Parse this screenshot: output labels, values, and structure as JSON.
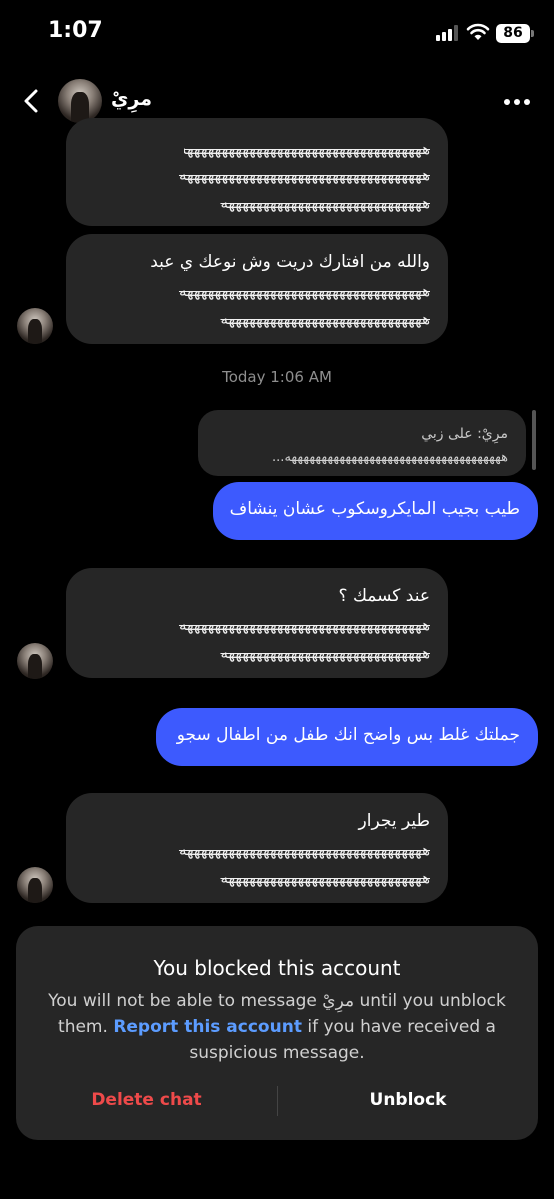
{
  "status_bar": {
    "time": "1:07",
    "battery": "86"
  },
  "header": {
    "contact_name": "مرِيْ"
  },
  "messages": {
    "m1": {
      "laugh_1": "هههههههههههههههههههههههههههههههههههه",
      "laugh_2": "هههههههههههههههههههههههههههههههههههه",
      "laugh_3": "هههههههههههههههههههههههههههههه"
    },
    "m2": {
      "text": "والله من افتارك دريت وش نوعك ي عبد",
      "laugh_1": "هههههههههههههههههههههههههههههههههههه",
      "laugh_2": "هههههههههههههههههههههههههههههه"
    },
    "timestamp": "Today 1:06 AM",
    "reply": {
      "name": "مرِيْ: على زبي",
      "text": "ههههههههههههههههههههههههههههههههههههه..."
    },
    "m3": {
      "text": "طيب بجيب المايكروسكوب عشان ينشاف"
    },
    "m4": {
      "text": "عند كسمك ؟",
      "laugh_1": "هههههههههههههههههههههههههههههههههههه",
      "laugh_2": "هههههههههههههههههههههههههههههه"
    },
    "m5": {
      "text": "جملتك غلط بس واضح انك طفل من اطفال سجو"
    },
    "m6": {
      "text": "طير يجرار",
      "laugh_1": "هههههههههههههههههههههههههههههههههههه",
      "laugh_2": "هههههههههههههههههههههههههههههه"
    }
  },
  "blocked_panel": {
    "title": "You blocked this account",
    "desc_part1": "You will not be able to message ",
    "desc_name": "مرِيْ",
    "desc_part2": " until you unblock them. ",
    "report_link": "Report this account",
    "desc_part3": " if you have received a suspicious message.",
    "delete_label": "Delete chat",
    "unblock_label": "Unblock"
  },
  "colors": {
    "outgoing_bubble": "#3d5afe",
    "incoming_bubble": "#262626",
    "link": "#5c9cff",
    "danger": "#ee4a4a"
  }
}
